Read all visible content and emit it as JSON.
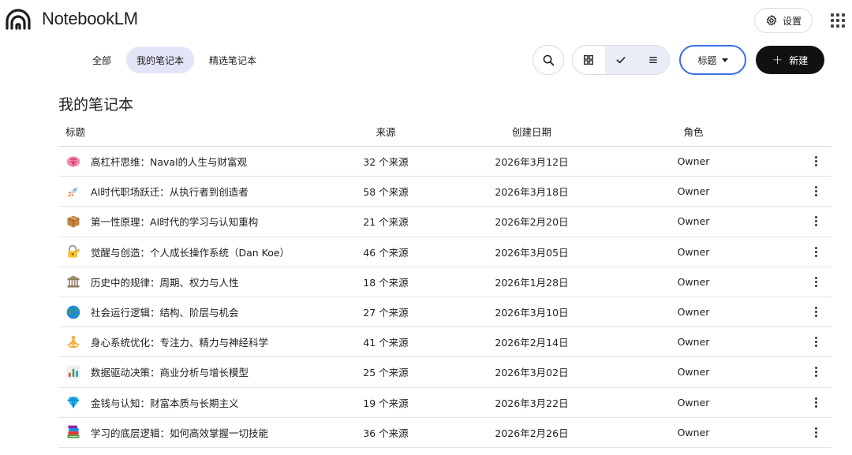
{
  "header": {
    "app_title": "NotebookLM",
    "settings_label": "设置"
  },
  "tabs": [
    {
      "label": "全部",
      "active": false
    },
    {
      "label": "我的笔记本",
      "active": true
    },
    {
      "label": "精选笔记本",
      "active": false
    }
  ],
  "toolbar": {
    "sort_label": "标题",
    "new_label": "新建",
    "view_mode": "grid-check-list"
  },
  "section_title": "我的笔记本",
  "columns": [
    "标题",
    "来源",
    "创建日期",
    "角色"
  ],
  "rows": [
    {
      "icon": "brain-icon",
      "title": "高杠杆思维：Naval的人生与财富观",
      "sources": "32 个来源",
      "date": "2026年3月12日",
      "role": "Owner"
    },
    {
      "icon": "rocket-icon",
      "title": "AI时代职场跃迁：从执行者到创造者",
      "sources": "58 个来源",
      "date": "2026年3月18日",
      "role": "Owner"
    },
    {
      "icon": "package-icon",
      "title": "第一性原理：AI时代的学习与认知重构",
      "sources": "21 个来源",
      "date": "2026年2月20日",
      "role": "Owner"
    },
    {
      "icon": "lock-key-icon",
      "title": "觉醒与创造：个人成长操作系统（Dan Koe）",
      "sources": "46 个来源",
      "date": "2026年3月05日",
      "role": "Owner"
    },
    {
      "icon": "classical-building-icon",
      "title": "历史中的规律：周期、权力与人性",
      "sources": "18 个来源",
      "date": "2026年1月28日",
      "role": "Owner"
    },
    {
      "icon": "globe-icon",
      "title": "社会运行逻辑：结构、阶层与机会",
      "sources": "27 个来源",
      "date": "2026年3月10日",
      "role": "Owner"
    },
    {
      "icon": "meditation-icon",
      "title": "身心系统优化：专注力、精力与神经科学",
      "sources": "41 个来源",
      "date": "2026年2月14日",
      "role": "Owner"
    },
    {
      "icon": "bar-chart-icon",
      "title": "数据驱动决策：商业分析与增长模型",
      "sources": "25 个来源",
      "date": "2026年3月02日",
      "role": "Owner"
    },
    {
      "icon": "gem-icon",
      "title": "金钱与认知：财富本质与长期主义",
      "sources": "19 个来源",
      "date": "2026年3月22日",
      "role": "Owner"
    },
    {
      "icon": "books-icon",
      "title": "学习的底层逻辑：如何高效掌握一切技能",
      "sources": "36 个来源",
      "date": "2026年2月26日",
      "role": "Owner"
    }
  ],
  "colors": {
    "accent": "#3b6ee6",
    "active_tab_bg": "#e2e4f7",
    "new_button_bg": "#111111"
  }
}
